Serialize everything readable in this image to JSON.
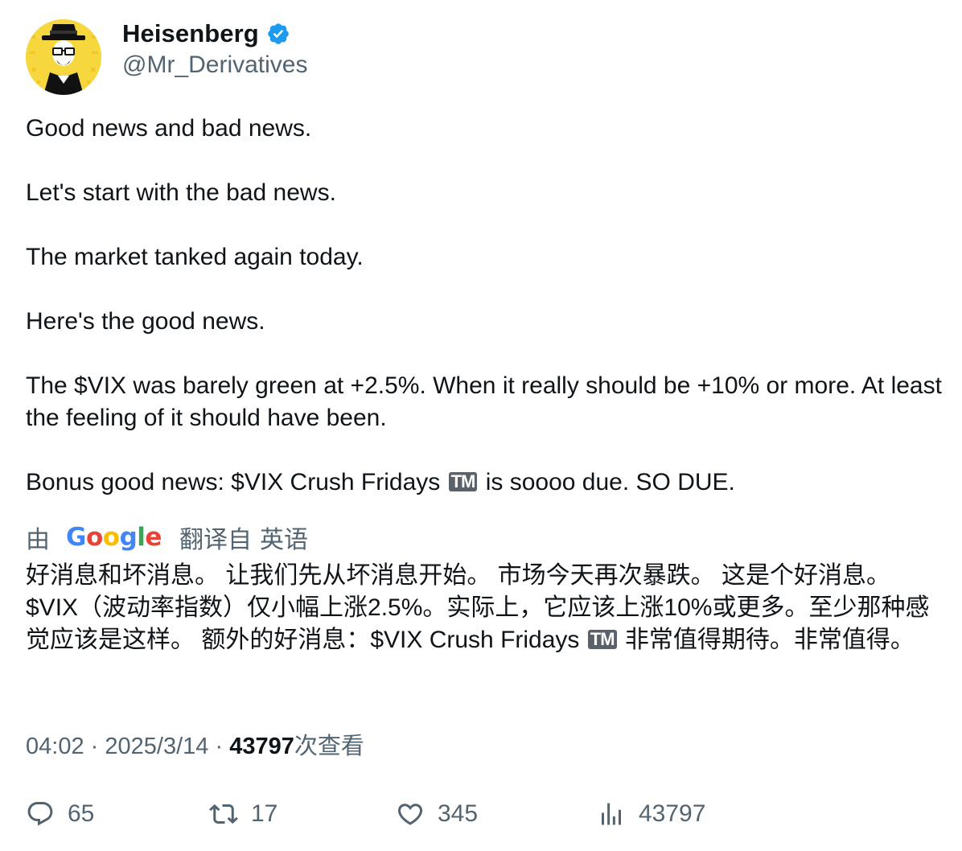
{
  "author": {
    "display_name": "Heisenberg",
    "handle": "@Mr_Derivatives",
    "verified": true,
    "avatar_icon": "heisenberg-avatar"
  },
  "tweet": {
    "lines": [
      "Good news and bad news.",
      "Let's start with the bad news.",
      "The market tanked again today.",
      "Here's the good news.",
      "The $VIX was barely green at +2.5%. When it really should be +10% or more. At least the feeling of it should have been.",
      "Bonus good news: $VIX Crush Fridays",
      "is soooo due. SO DUE."
    ],
    "tm_symbol": "TM"
  },
  "translation": {
    "by_label": "由",
    "google_letters": [
      "G",
      "o",
      "o",
      "g",
      "l",
      "e"
    ],
    "translated_from_label": "翻译自",
    "language": "英语",
    "text_before_tm": "好消息和坏消息。 让我们先从坏消息开始。 市场今天再次暴跌。 这是个好消息。 $VIX（波动率指数）仅小幅上涨2.5%。实际上，它应该上涨10%或更多。至少那种感觉应该是这样。 额外的好消息：$VIX Crush Fridays",
    "text_after_tm": "非常值得期待。非常值得。",
    "tm_symbol": "TM"
  },
  "meta": {
    "time": "04:02",
    "separator": "·",
    "date": "2025/3/14",
    "views_count": "43797",
    "views_label": "次查看"
  },
  "actions": {
    "replies": "65",
    "retweets": "17",
    "likes": "345",
    "views": "43797"
  },
  "colors": {
    "text_primary": "#0f1419",
    "text_secondary": "#536471",
    "verified_blue": "#1d9bf0",
    "avatar_bg": "#f6d73e"
  }
}
